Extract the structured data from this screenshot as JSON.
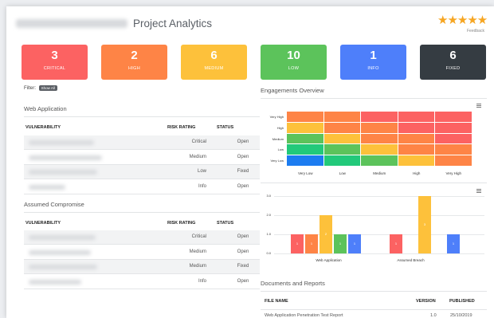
{
  "header": {
    "title": "Project Analytics",
    "stars": "★★★★★",
    "feedback_label": "Feedback"
  },
  "stats": [
    {
      "value": "3",
      "label": "CRITICAL",
      "color": "#fc6262"
    },
    {
      "value": "2",
      "label": "HIGH",
      "color": "#fe8446"
    },
    {
      "value": "6",
      "label": "MEDIUM",
      "color": "#fdc13b"
    },
    {
      "value": "10",
      "label": "LOW",
      "color": "#5cc35b"
    },
    {
      "value": "1",
      "label": "INFO",
      "color": "#4e7ffa"
    },
    {
      "value": "6",
      "label": "FIXED",
      "color": "#353c42"
    }
  ],
  "filter": {
    "label": "Filter:",
    "button": "Show All"
  },
  "web_application": {
    "title": "Web Application",
    "headers": [
      "VULNERABILITY",
      "RISK RATING",
      "STATUS"
    ],
    "rows": [
      {
        "risk": "Critical",
        "status": "Open"
      },
      {
        "risk": "Medium",
        "status": "Open"
      },
      {
        "risk": "Low",
        "status": "Fixed"
      },
      {
        "risk": "Info",
        "status": "Open"
      }
    ]
  },
  "assumed_compromise": {
    "title": "Assumed Compromise",
    "headers": [
      "VULNERABILITY",
      "RISK RATING",
      "STATUS"
    ],
    "rows": [
      {
        "risk": "Critical",
        "status": "Open"
      },
      {
        "risk": "Medium",
        "status": "Open"
      },
      {
        "risk": "Medium",
        "status": "Fixed"
      },
      {
        "risk": "Info",
        "status": "Open"
      }
    ]
  },
  "engagements": {
    "title": "Engagements Overview"
  },
  "chart_data": [
    {
      "type": "heatmap",
      "y_categories": [
        "Very High",
        "High",
        "Medium",
        "Low",
        "Very Low"
      ],
      "x_categories": [
        "Very Low",
        "Low",
        "Medium",
        "High",
        "Very High"
      ],
      "colors": [
        [
          "#fe8446",
          "#fe8446",
          "#fc6262",
          "#fc6262",
          "#fc6262"
        ],
        [
          "#fdc13b",
          "#fe8446",
          "#fe8446",
          "#fc6262",
          "#fc6262"
        ],
        [
          "#5cc35b",
          "#fdc13b",
          "#fe8446",
          "#fe8446",
          "#fc6262"
        ],
        [
          "#22c97a",
          "#5cc35b",
          "#fdc13b",
          "#fe8446",
          "#fe8446"
        ],
        [
          "#1c7cf0",
          "#22c97a",
          "#5cc35b",
          "#fdc13b",
          "#fe8446"
        ]
      ]
    },
    {
      "type": "bar",
      "categories": [
        "Web Application",
        "Assumed Breach"
      ],
      "yticks": [
        "0.0",
        "1.0",
        "2.0",
        "3.0"
      ],
      "ylim": [
        0,
        3
      ],
      "series": [
        {
          "color": "#fc6262",
          "values": [
            1,
            1
          ]
        },
        {
          "color": "#fe8446",
          "values": [
            1,
            0
          ]
        },
        {
          "color": "#fdc13b",
          "values": [
            2,
            3
          ]
        },
        {
          "color": "#5cc35b",
          "values": [
            1,
            0
          ]
        },
        {
          "color": "#4e7ffa",
          "values": [
            1,
            1
          ]
        }
      ]
    }
  ],
  "documents": {
    "title": "Documents and Reports",
    "headers": [
      "FILE NAME",
      "VERSION",
      "PUBLISHED"
    ],
    "rows": [
      {
        "name": "Web Application Penetration Test Report",
        "version": "1.0",
        "published": "25/10/2019"
      }
    ]
  }
}
